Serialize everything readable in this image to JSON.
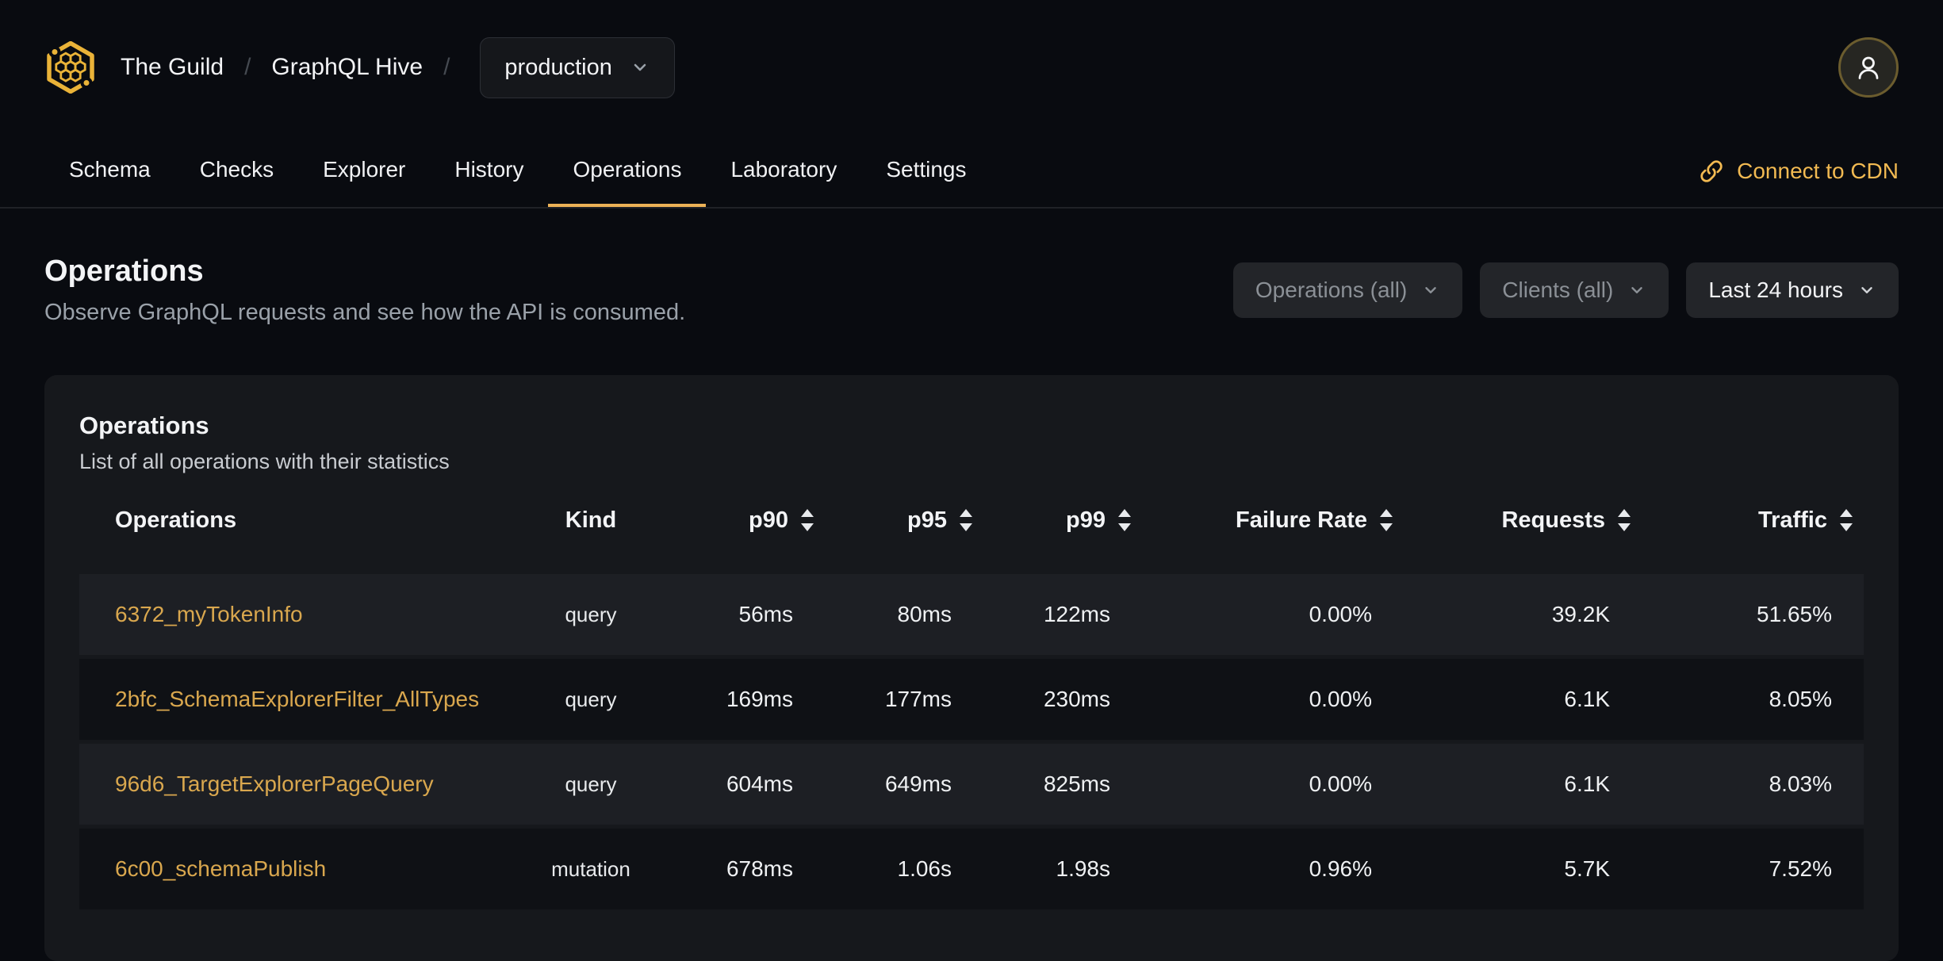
{
  "header": {
    "org": "The Guild",
    "separator": "/",
    "project": "GraphQL Hive",
    "target": "production"
  },
  "nav": {
    "tabs": [
      "Schema",
      "Checks",
      "Explorer",
      "History",
      "Operations",
      "Laboratory",
      "Settings"
    ],
    "active_tab": "Operations",
    "cdn_link": "Connect to CDN"
  },
  "page": {
    "title": "Operations",
    "subtitle": "Observe GraphQL requests and see how the API is consumed."
  },
  "filters": {
    "operations_label": "Operations (all)",
    "clients_label": "Clients (all)",
    "period_label": "Last 24 hours"
  },
  "panel": {
    "title": "Operations",
    "subtitle": "List of all operations with their statistics"
  },
  "table": {
    "columns": [
      {
        "label": "Operations",
        "sortable": false
      },
      {
        "label": "Kind",
        "sortable": false
      },
      {
        "label": "p90",
        "sortable": true
      },
      {
        "label": "p95",
        "sortable": true
      },
      {
        "label": "p99",
        "sortable": true
      },
      {
        "label": "Failure Rate",
        "sortable": true
      },
      {
        "label": "Requests",
        "sortable": true
      },
      {
        "label": "Traffic",
        "sortable": true
      }
    ],
    "rows": [
      {
        "name": "6372_myTokenInfo",
        "kind": "query",
        "p90": "56ms",
        "p95": "80ms",
        "p99": "122ms",
        "failure_rate": "0.00%",
        "requests": "39.2K",
        "traffic": "51.65%"
      },
      {
        "name": "2bfc_SchemaExplorerFilter_AllTypes",
        "kind": "query",
        "p90": "169ms",
        "p95": "177ms",
        "p99": "230ms",
        "failure_rate": "0.00%",
        "requests": "6.1K",
        "traffic": "8.05%"
      },
      {
        "name": "96d6_TargetExplorerPageQuery",
        "kind": "query",
        "p90": "604ms",
        "p95": "649ms",
        "p99": "825ms",
        "failure_rate": "0.00%",
        "requests": "6.1K",
        "traffic": "8.03%"
      },
      {
        "name": "6c00_schemaPublish",
        "kind": "mutation",
        "p90": "678ms",
        "p95": "1.06s",
        "p99": "1.98s",
        "failure_rate": "0.96%",
        "requests": "5.7K",
        "traffic": "7.52%"
      }
    ]
  },
  "colors": {
    "accent": "#ecb257",
    "logo_gold": "#eab338",
    "operation_link": "#d9a74e",
    "page_bg": "#090b10",
    "panel_bg": "#16181c"
  }
}
